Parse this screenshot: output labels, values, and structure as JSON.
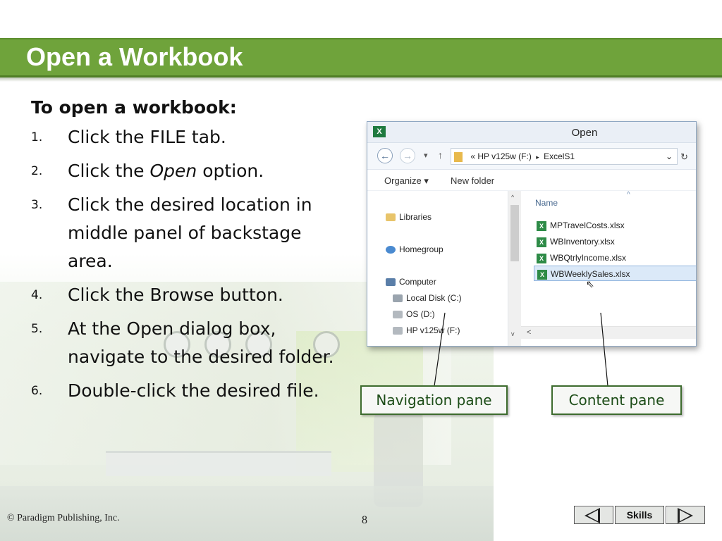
{
  "slide": {
    "title": "Open a Workbook",
    "intro": "To open a workbook:",
    "steps": [
      {
        "num": "1.",
        "before": "Click the FILE tab.",
        "em": "",
        "after": ""
      },
      {
        "num": "2.",
        "before": "Click the ",
        "em": "Open",
        "after": " option."
      },
      {
        "num": "3.",
        "before": "Click the desired location in middle panel of backstage area.",
        "em": "",
        "after": ""
      },
      {
        "num": "4.",
        "before": "Click the Browse button.",
        "em": "",
        "after": ""
      },
      {
        "num": "5.",
        "before": "At the Open dialog box, navigate to the desired folder.",
        "em": "",
        "after": ""
      },
      {
        "num": "6.",
        "before": "Double-click the desired file.",
        "em": "",
        "after": ""
      }
    ]
  },
  "dialog": {
    "title": "Open",
    "app_icon": "excel-icon",
    "back_glyph": "←",
    "forward_glyph": "→",
    "dropdown_glyph": "▾",
    "up_glyph": "↑",
    "address": {
      "prefix": "«",
      "segments": [
        "HP v125w (F:)",
        "ExcelS1"
      ],
      "separator": "▸",
      "dropdown": "⌄",
      "refresh": "↻"
    },
    "toolbar": {
      "organize": "Organize ▾",
      "new_folder": "New folder"
    },
    "nav_pane": [
      {
        "label": "Libraries",
        "icon": "libraries-icon"
      },
      {
        "label": "Homegroup",
        "icon": "homegroup-icon"
      },
      {
        "label": "Computer",
        "icon": "computer-icon"
      },
      {
        "label": "Local Disk (C:)",
        "icon": "drive-icon"
      },
      {
        "label": "OS (D:)",
        "icon": "drive-icon"
      },
      {
        "label": "HP v125w (F:)",
        "icon": "usb-drive-icon"
      }
    ],
    "content_pane": {
      "column_header": "Name",
      "sort_caret": "^",
      "files": [
        "MPTravelCosts.xlsx",
        "WBInventory.xlsx",
        "WBQtrlyIncome.xlsx",
        "WBWeeklySales.xlsx"
      ],
      "selected_file": "WBWeeklySales.xlsx"
    },
    "scroll_up": "^",
    "scroll_down": "v",
    "scroll_left": "<"
  },
  "callouts": {
    "navigation_pane": "Navigation pane",
    "content_pane": "Content pane"
  },
  "footer": {
    "copyright": "© Paradigm Publishing, Inc.",
    "page_number": "8",
    "skills": "Skills"
  },
  "colors": {
    "title_bar": "#6fa33b",
    "callout_border": "#3d6b2e",
    "selection": "#dbe9f8"
  }
}
